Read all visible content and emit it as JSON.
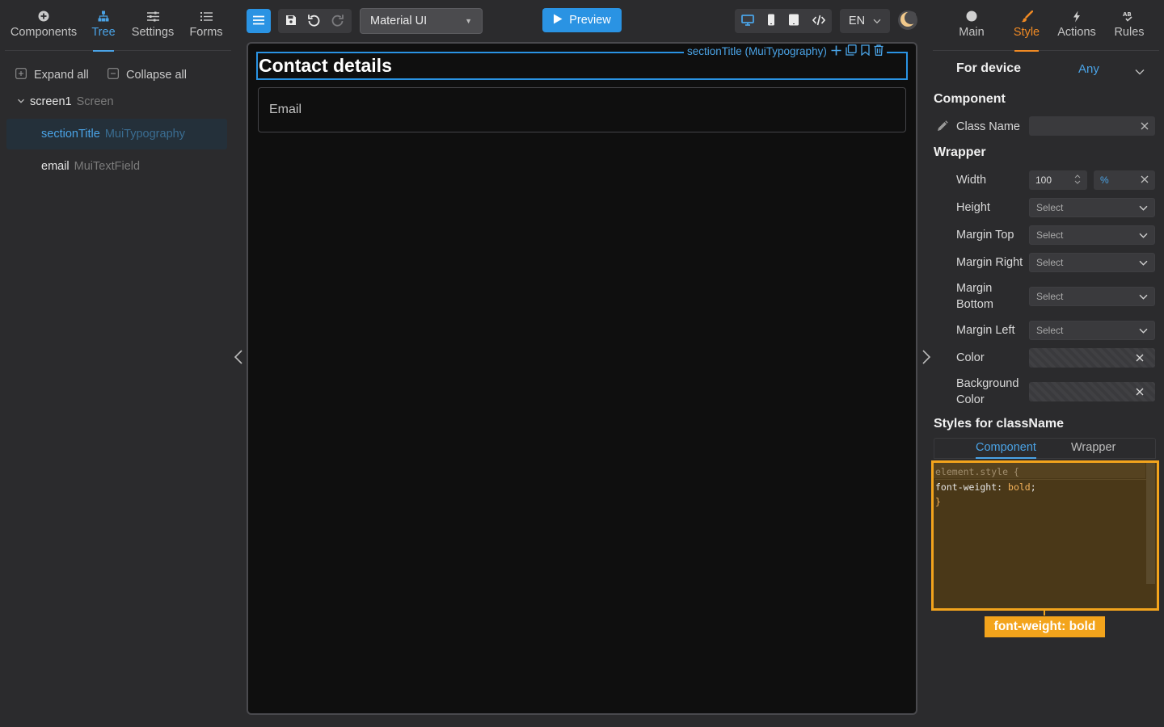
{
  "left_panel": {
    "tabs": [
      {
        "label": "Components",
        "icon": "plus-circle-icon",
        "active": false
      },
      {
        "label": "Tree",
        "icon": "hierarchy-icon",
        "active": true
      },
      {
        "label": "Settings",
        "icon": "sliders-icon",
        "active": false
      },
      {
        "label": "Forms",
        "icon": "list-icon",
        "active": false
      }
    ],
    "expand_all": "Expand all",
    "collapse_all": "Collapse all",
    "tree": [
      {
        "name": "screen1",
        "type": "Screen"
      },
      {
        "name": "sectionTitle",
        "type": "MuiTypography"
      },
      {
        "name": "email",
        "type": "MuiTextField"
      }
    ]
  },
  "toolbar": {
    "library": "Material UI",
    "preview": "Preview",
    "language": "EN"
  },
  "canvas": {
    "selection_label": "sectionTitle (MuiTypography)",
    "title_text": "Contact details",
    "email_label": "Email"
  },
  "right_panel": {
    "tabs": [
      {
        "label": "Main",
        "icon": "circle-icon",
        "active": false
      },
      {
        "label": "Style",
        "icon": "brush-icon",
        "active": true
      },
      {
        "label": "Actions",
        "icon": "lightning-icon",
        "active": false
      },
      {
        "label": "Rules",
        "icon": "rules-icon",
        "active": false
      }
    ],
    "for_device_label": "For device",
    "for_device_value": "Any",
    "component_heading": "Component",
    "class_name_label": "Class Name",
    "class_name_value": "",
    "wrapper_heading": "Wrapper",
    "width_label": "Width",
    "width_value": "100",
    "width_unit": "%",
    "height_label": "Height",
    "margin_top_label": "Margin Top",
    "margin_right_label": "Margin Right",
    "margin_bottom_label_1": "Margin",
    "margin_bottom_label_2": "Bottom",
    "margin_left_label": "Margin Left",
    "select_placeholder": "Select",
    "color_label": "Color",
    "bg_color_label_1": "Background",
    "bg_color_label_2": "Color",
    "styles_heading": "Styles for className",
    "style_tabs": [
      "Component",
      "Wrapper"
    ],
    "code_lines": [
      "element.style {",
      "font-weight: ",
      "bold",
      ";",
      "}"
    ],
    "hint": "font-weight: bold"
  },
  "colors": {
    "accent_blue": "#2a93e3",
    "accent_orange": "#f08a24",
    "highlight": "#f3a41c"
  }
}
